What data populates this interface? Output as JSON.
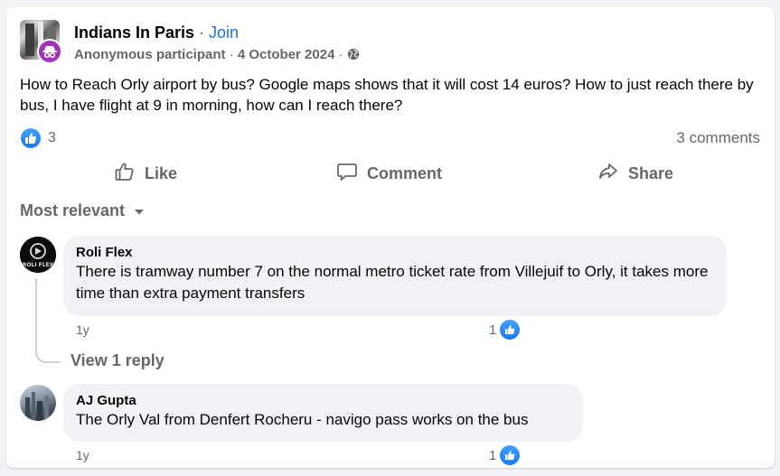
{
  "post": {
    "group_name": "Indians In Paris",
    "separator": " · ",
    "join_label": "Join",
    "author": "Anonymous participant",
    "date": "4 October 2024",
    "audience_icon": "globe-icon",
    "text": "How to Reach Orly airport by bus? Google maps shows that it will cost 14 euros? How to just reach there by bus, I have flight at 9 in morning, how can I reach there?",
    "reaction_count": "3",
    "comments_count": "3 comments"
  },
  "actions": {
    "like": "Like",
    "comment": "Comment",
    "share": "Share"
  },
  "sort": {
    "label": "Most relevant"
  },
  "comments": [
    {
      "author": "Roli Flex",
      "avatar_text": "ROLI FLEX",
      "text": "There is tramway number 7 on the normal metro ticket rate from Villejuif to Orly, it takes more time than extra payment transfers",
      "time": "1y",
      "likes": "1",
      "view_replies": "View 1 reply"
    },
    {
      "author": "AJ Gupta",
      "text": "The Orly Val from Denfert Rocheru - navigo pass works on the bus",
      "time": "1y",
      "likes": "1"
    }
  ],
  "colors": {
    "accent": "#1877f2",
    "join_link": "#1c6ed6",
    "muted_text": "#65676b",
    "anon_badge": "#a034b6",
    "bubble_bg": "#f0f2f5"
  }
}
